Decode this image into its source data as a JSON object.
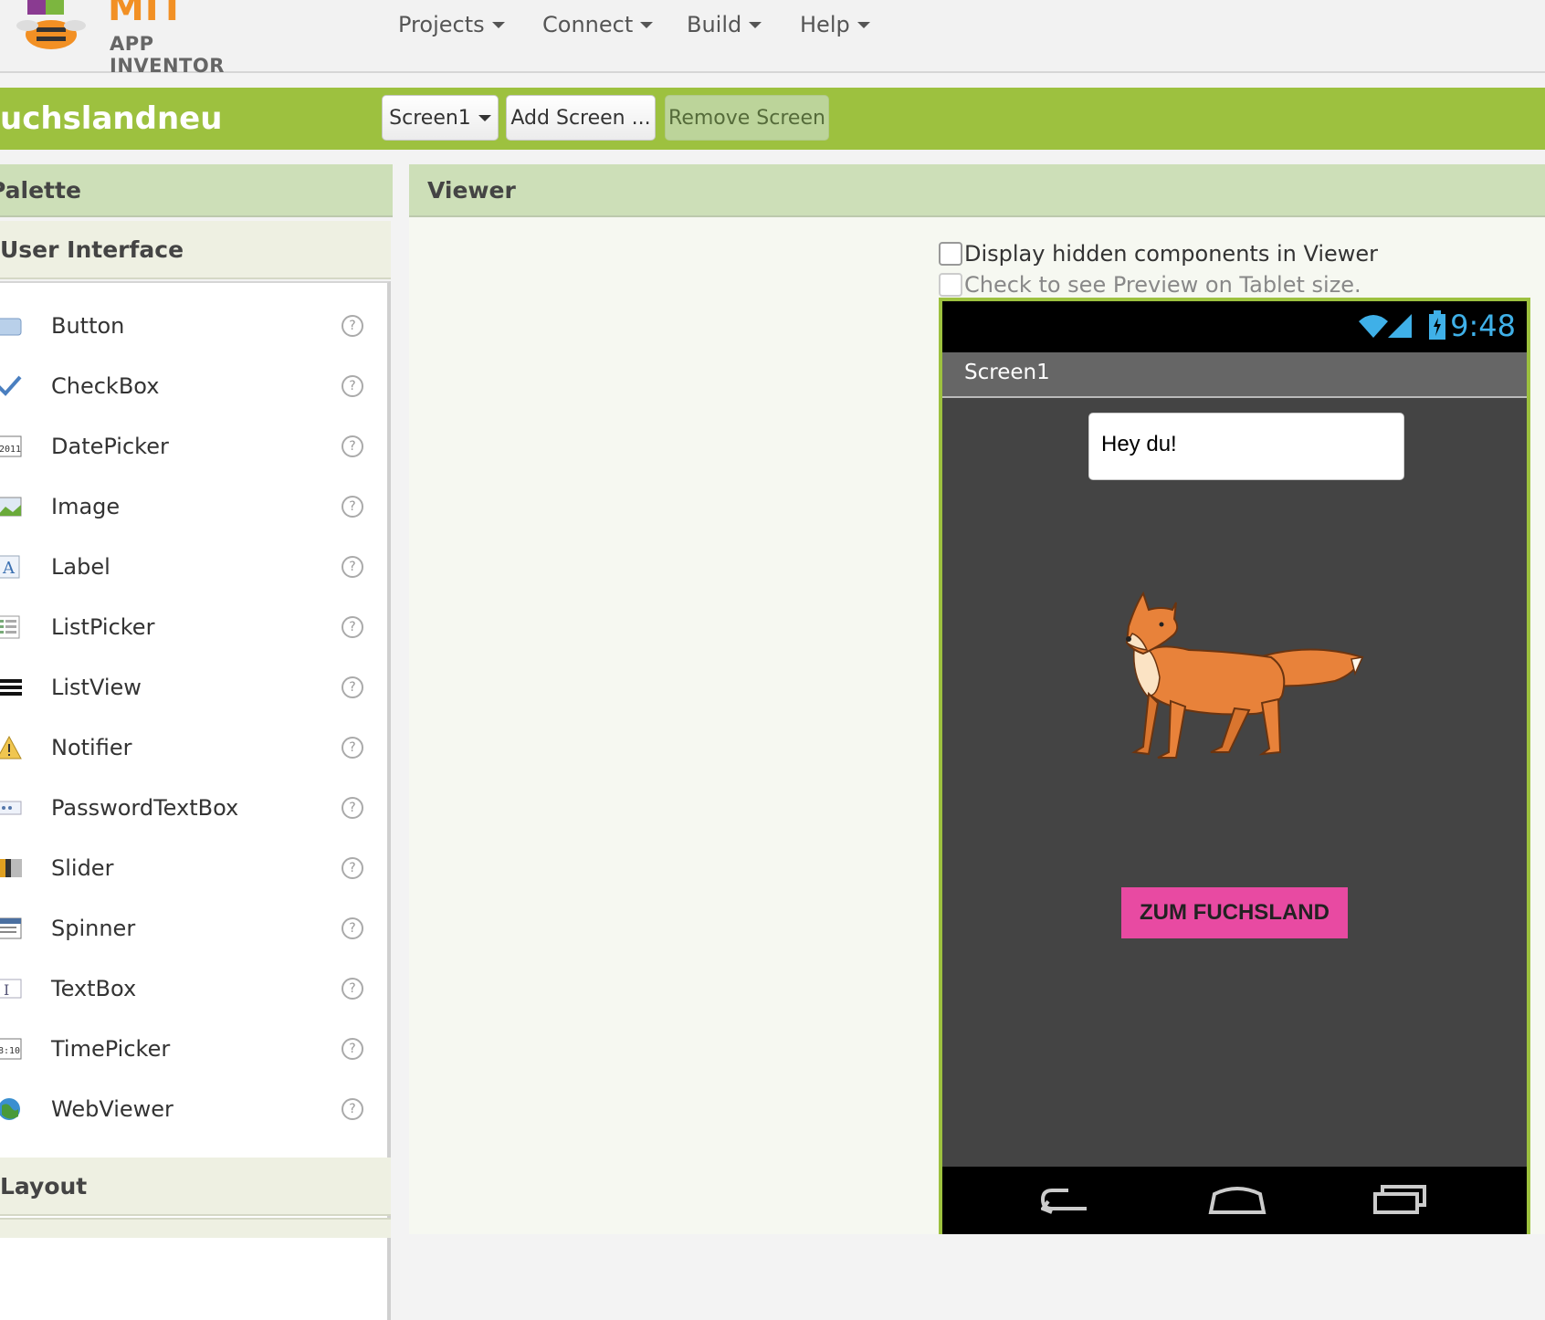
{
  "header": {
    "logo_title": "MIT",
    "logo_subtitle": "APP INVENTOR",
    "menu": [
      "Projects",
      "Connect",
      "Build",
      "Help"
    ]
  },
  "project_bar": {
    "project_name": "uchslandneu",
    "screen_select": "Screen1",
    "add_screen": "Add Screen ...",
    "remove_screen": "Remove Screen"
  },
  "palette": {
    "title": "Palette",
    "section_user_interface": "User Interface",
    "components": [
      {
        "label": "Button",
        "icon": "button-icon"
      },
      {
        "label": "CheckBox",
        "icon": "checkbox-icon"
      },
      {
        "label": "DatePicker",
        "icon": "datepicker-icon"
      },
      {
        "label": "Image",
        "icon": "image-icon"
      },
      {
        "label": "Label",
        "icon": "label-icon"
      },
      {
        "label": "ListPicker",
        "icon": "listpicker-icon"
      },
      {
        "label": "ListView",
        "icon": "listview-icon"
      },
      {
        "label": "Notifier",
        "icon": "notifier-icon"
      },
      {
        "label": "PasswordTextBox",
        "icon": "passwordtextbox-icon"
      },
      {
        "label": "Slider",
        "icon": "slider-icon"
      },
      {
        "label": "Spinner",
        "icon": "spinner-icon"
      },
      {
        "label": "TextBox",
        "icon": "textbox-icon"
      },
      {
        "label": "TimePicker",
        "icon": "timepicker-icon"
      },
      {
        "label": "WebViewer",
        "icon": "webviewer-icon"
      }
    ],
    "help_glyph": "?",
    "section_layout": "Layout"
  },
  "viewer": {
    "title": "Viewer",
    "hidden_components_label": "Display hidden components in Viewer",
    "tablet_preview_label": "Check to see Preview on Tablet size.",
    "phone": {
      "clock": "9:48",
      "screen_title": "Screen1",
      "label_text": "Hey du!",
      "button_text": "ZUM FUCHSLAND"
    }
  },
  "colors": {
    "brand_green": "#9dc13f",
    "panel_header": "#cddfb8",
    "button_pink": "#e84aa2",
    "phone_bg": "#444444",
    "logo_orange": "#f29024"
  }
}
